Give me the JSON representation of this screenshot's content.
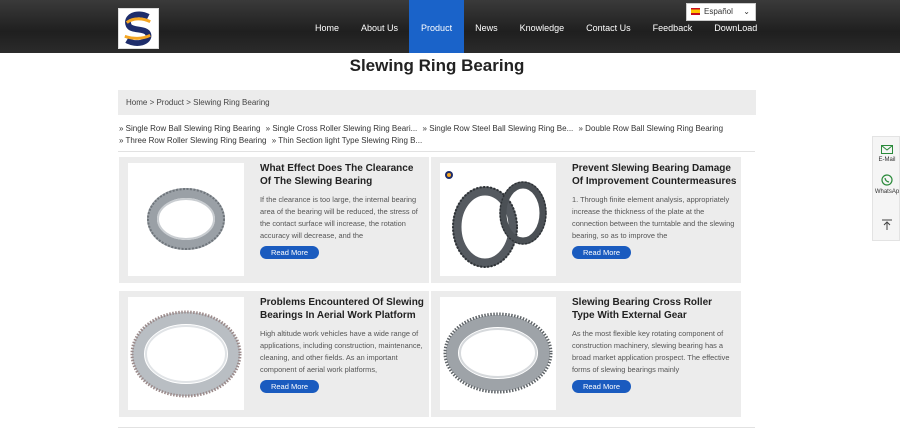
{
  "nav": [
    "Home",
    "About Us",
    "Product",
    "News",
    "Knowledge",
    "Contact Us",
    "Feedback",
    "DownLoad"
  ],
  "language": "Español",
  "page_title": "Slewing Ring Bearing",
  "breadcrumb": "Home > Product > Slewing Ring Bearing",
  "categories": [
    "» Single Row Ball Slewing Ring Bearing",
    "» Single Cross Roller Slewing Ring Beari...",
    "» Single Row Steel Ball Slewing Ring Be...",
    "» Double Row Ball Slewing Ring Bearing",
    "» Three Row Roller Slewing Ring Bearing",
    "» Thin Section light Type Slewing Ring B..."
  ],
  "read_more": "Read More",
  "articles": [
    {
      "title": "What Effect Does The Clearance Of The Slewing Bearing",
      "text": "If the clearance is too large, the internal bearing area of the bearing will be reduced, the stress of the contact surface will increase, the rotation accuracy will decrease, and the"
    },
    {
      "title": "Prevent Slewing Bearing Damage Of Improvement Countermeasures",
      "text": "1. Through finite element analysis, appropriately increase the thickness of the plate at the connection between the turntable and the slewing bearing, so as to improve the"
    },
    {
      "title": "Problems Encountered Of Slewing Bearings In Aerial Work Platform",
      "text": "High altitude work vehicles have a wide range of applications, including construction, maintenance, cleaning, and other fields. As an important component of aerial work platforms,"
    },
    {
      "title": "Slewing Bearing Cross Roller Type With External Gear",
      "text": "As the most flexible key rotating component of construction machinery, slewing bearing has a broad market application prospect. The effective forms of slewing bearings mainly"
    }
  ],
  "side": {
    "email": "E-Mail",
    "whatsapp": "WhatsAp"
  },
  "colors": {
    "nav_active": "#1a63c9",
    "button": "#1a5bbf",
    "header": "#2b2b2b"
  }
}
